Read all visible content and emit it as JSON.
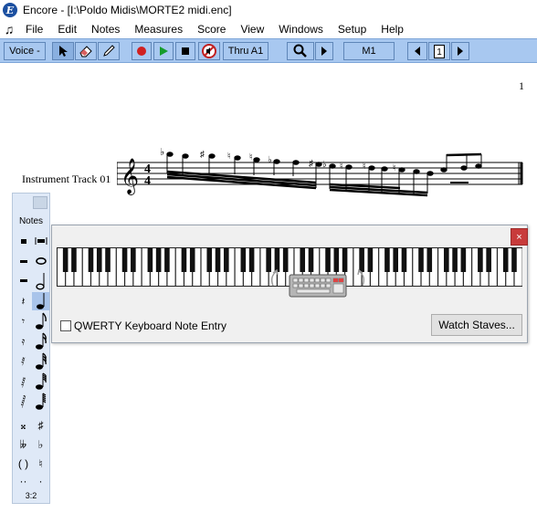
{
  "window": {
    "title": "Encore - [I:\\Poldo Midis\\MORTE2 midi.enc]",
    "app_icon_letter": "E",
    "app_icon_color": "#1b4fa0"
  },
  "menubar": {
    "note_glyph": "♫",
    "items": [
      "File",
      "Edit",
      "Notes",
      "Measures",
      "Score",
      "View",
      "Windows",
      "Setup",
      "Help"
    ]
  },
  "toolbar": {
    "voice_label": "Voice -",
    "thru_label": "Thru A1",
    "measure_label": "M1",
    "page_label": "1",
    "background_color": "#a8c8f0"
  },
  "score": {
    "page_number": "1",
    "track_label": "Instrument Track 01",
    "time_signature_top": "4",
    "time_signature_bottom": "4"
  },
  "palette": {
    "title": "Notes",
    "footer": "3:2"
  },
  "keyboard_window": {
    "close_label": "×",
    "qwerty_label": "QWERTY Keyboard Note Entry",
    "qwerty_checked": false,
    "watch_staves_label": "Watch Staves...",
    "close_color": "#c83b3b"
  }
}
